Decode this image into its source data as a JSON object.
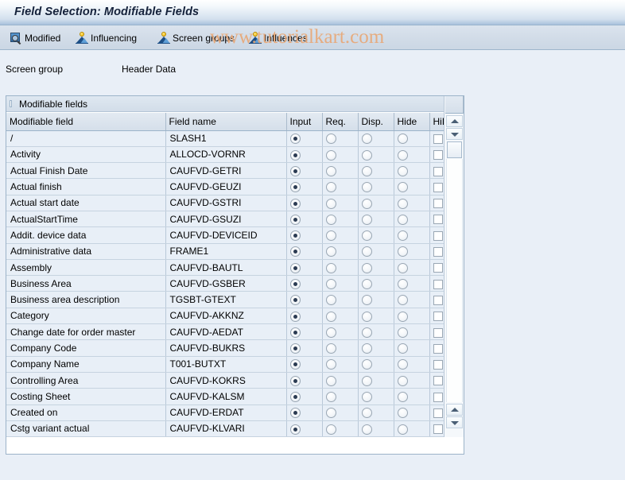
{
  "window": {
    "title": "Field Selection: Modifiable Fields"
  },
  "toolbar": {
    "buttons": [
      {
        "label": "Modified",
        "icon": "magnifier-page-icon"
      },
      {
        "label": "Influencing",
        "icon": "mountain-sunrise-icon"
      },
      {
        "label": "Screen groups",
        "icon": "mountain-sunrise-icon"
      },
      {
        "label": "Influences",
        "icon": "mountain-sunrise-icon"
      }
    ]
  },
  "watermark": {
    "text": "www.tutorialkart.com"
  },
  "screen_group": {
    "label": "Screen group",
    "value": "Header Data"
  },
  "panel": {
    "header": "Modifiable fields"
  },
  "table": {
    "columns": [
      "Modifiable field",
      "Field name",
      "Input",
      "Req.",
      "Disp.",
      "Hide",
      "HiLi"
    ],
    "rows": [
      {
        "modifiable_field": "/",
        "field_name": "SLASH1",
        "input": true,
        "req": false,
        "disp": false,
        "hide": false,
        "hili": false
      },
      {
        "modifiable_field": "Activity",
        "field_name": "ALLOCD-VORNR",
        "input": true,
        "req": false,
        "disp": false,
        "hide": false,
        "hili": false
      },
      {
        "modifiable_field": "Actual Finish Date",
        "field_name": "CAUFVD-GETRI",
        "input": true,
        "req": false,
        "disp": false,
        "hide": false,
        "hili": false
      },
      {
        "modifiable_field": "Actual finish",
        "field_name": "CAUFVD-GEUZI",
        "input": true,
        "req": false,
        "disp": false,
        "hide": false,
        "hili": false
      },
      {
        "modifiable_field": "Actual start date",
        "field_name": "CAUFVD-GSTRI",
        "input": true,
        "req": false,
        "disp": false,
        "hide": false,
        "hili": false
      },
      {
        "modifiable_field": "ActualStartTime",
        "field_name": "CAUFVD-GSUZI",
        "input": true,
        "req": false,
        "disp": false,
        "hide": false,
        "hili": false
      },
      {
        "modifiable_field": "Addit. device data",
        "field_name": "CAUFVD-DEVICEID",
        "input": true,
        "req": false,
        "disp": false,
        "hide": false,
        "hili": false
      },
      {
        "modifiable_field": "Administrative data",
        "field_name": "FRAME1",
        "input": true,
        "req": false,
        "disp": false,
        "hide": false,
        "hili": false
      },
      {
        "modifiable_field": "Assembly",
        "field_name": "CAUFVD-BAUTL",
        "input": true,
        "req": false,
        "disp": false,
        "hide": false,
        "hili": false
      },
      {
        "modifiable_field": "Business Area",
        "field_name": "CAUFVD-GSBER",
        "input": true,
        "req": false,
        "disp": false,
        "hide": false,
        "hili": false
      },
      {
        "modifiable_field": "Business area description",
        "field_name": "TGSBT-GTEXT",
        "input": true,
        "req": false,
        "disp": false,
        "hide": false,
        "hili": false
      },
      {
        "modifiable_field": "Category",
        "field_name": "CAUFVD-AKKNZ",
        "input": true,
        "req": false,
        "disp": false,
        "hide": false,
        "hili": false
      },
      {
        "modifiable_field": "Change date for order master",
        "field_name": "CAUFVD-AEDAT",
        "input": true,
        "req": false,
        "disp": false,
        "hide": false,
        "hili": false
      },
      {
        "modifiable_field": "Company Code",
        "field_name": "CAUFVD-BUKRS",
        "input": true,
        "req": false,
        "disp": false,
        "hide": false,
        "hili": false
      },
      {
        "modifiable_field": "Company Name",
        "field_name": "T001-BUTXT",
        "input": true,
        "req": false,
        "disp": false,
        "hide": false,
        "hili": false
      },
      {
        "modifiable_field": "Controlling Area",
        "field_name": "CAUFVD-KOKRS",
        "input": true,
        "req": false,
        "disp": false,
        "hide": false,
        "hili": false
      },
      {
        "modifiable_field": "Costing Sheet",
        "field_name": "CAUFVD-KALSM",
        "input": true,
        "req": false,
        "disp": false,
        "hide": false,
        "hili": false
      },
      {
        "modifiable_field": "Created on",
        "field_name": "CAUFVD-ERDAT",
        "input": true,
        "req": false,
        "disp": false,
        "hide": false,
        "hili": false
      },
      {
        "modifiable_field": "Cstg variant actual",
        "field_name": "CAUFVD-KLVARI",
        "input": true,
        "req": false,
        "disp": false,
        "hide": false,
        "hili": false
      }
    ]
  },
  "colors": {
    "titlebar_accent": "#a8c2dc",
    "row_background": "#e8eff7",
    "page_background": "#e9eff7",
    "watermark": "#e8a877"
  }
}
